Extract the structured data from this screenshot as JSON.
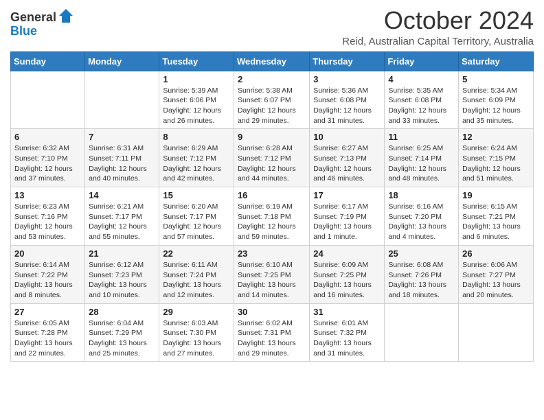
{
  "header": {
    "logo_general": "General",
    "logo_blue": "Blue",
    "title": "October 2024",
    "location": "Reid, Australian Capital Territory, Australia"
  },
  "weekdays": [
    "Sunday",
    "Monday",
    "Tuesday",
    "Wednesday",
    "Thursday",
    "Friday",
    "Saturday"
  ],
  "weeks": [
    [
      {
        "day": "",
        "info": ""
      },
      {
        "day": "",
        "info": ""
      },
      {
        "day": "1",
        "info": "Sunrise: 5:39 AM\nSunset: 6:06 PM\nDaylight: 12 hours and 26 minutes."
      },
      {
        "day": "2",
        "info": "Sunrise: 5:38 AM\nSunset: 6:07 PM\nDaylight: 12 hours and 29 minutes."
      },
      {
        "day": "3",
        "info": "Sunrise: 5:36 AM\nSunset: 6:08 PM\nDaylight: 12 hours and 31 minutes."
      },
      {
        "day": "4",
        "info": "Sunrise: 5:35 AM\nSunset: 6:08 PM\nDaylight: 12 hours and 33 minutes."
      },
      {
        "day": "5",
        "info": "Sunrise: 5:34 AM\nSunset: 6:09 PM\nDaylight: 12 hours and 35 minutes."
      }
    ],
    [
      {
        "day": "6",
        "info": "Sunrise: 6:32 AM\nSunset: 7:10 PM\nDaylight: 12 hours and 37 minutes."
      },
      {
        "day": "7",
        "info": "Sunrise: 6:31 AM\nSunset: 7:11 PM\nDaylight: 12 hours and 40 minutes."
      },
      {
        "day": "8",
        "info": "Sunrise: 6:29 AM\nSunset: 7:12 PM\nDaylight: 12 hours and 42 minutes."
      },
      {
        "day": "9",
        "info": "Sunrise: 6:28 AM\nSunset: 7:12 PM\nDaylight: 12 hours and 44 minutes."
      },
      {
        "day": "10",
        "info": "Sunrise: 6:27 AM\nSunset: 7:13 PM\nDaylight: 12 hours and 46 minutes."
      },
      {
        "day": "11",
        "info": "Sunrise: 6:25 AM\nSunset: 7:14 PM\nDaylight: 12 hours and 48 minutes."
      },
      {
        "day": "12",
        "info": "Sunrise: 6:24 AM\nSunset: 7:15 PM\nDaylight: 12 hours and 51 minutes."
      }
    ],
    [
      {
        "day": "13",
        "info": "Sunrise: 6:23 AM\nSunset: 7:16 PM\nDaylight: 12 hours and 53 minutes."
      },
      {
        "day": "14",
        "info": "Sunrise: 6:21 AM\nSunset: 7:17 PM\nDaylight: 12 hours and 55 minutes."
      },
      {
        "day": "15",
        "info": "Sunrise: 6:20 AM\nSunset: 7:17 PM\nDaylight: 12 hours and 57 minutes."
      },
      {
        "day": "16",
        "info": "Sunrise: 6:19 AM\nSunset: 7:18 PM\nDaylight: 12 hours and 59 minutes."
      },
      {
        "day": "17",
        "info": "Sunrise: 6:17 AM\nSunset: 7:19 PM\nDaylight: 13 hours and 1 minute."
      },
      {
        "day": "18",
        "info": "Sunrise: 6:16 AM\nSunset: 7:20 PM\nDaylight: 13 hours and 4 minutes."
      },
      {
        "day": "19",
        "info": "Sunrise: 6:15 AM\nSunset: 7:21 PM\nDaylight: 13 hours and 6 minutes."
      }
    ],
    [
      {
        "day": "20",
        "info": "Sunrise: 6:14 AM\nSunset: 7:22 PM\nDaylight: 13 hours and 8 minutes."
      },
      {
        "day": "21",
        "info": "Sunrise: 6:12 AM\nSunset: 7:23 PM\nDaylight: 13 hours and 10 minutes."
      },
      {
        "day": "22",
        "info": "Sunrise: 6:11 AM\nSunset: 7:24 PM\nDaylight: 13 hours and 12 minutes."
      },
      {
        "day": "23",
        "info": "Sunrise: 6:10 AM\nSunset: 7:25 PM\nDaylight: 13 hours and 14 minutes."
      },
      {
        "day": "24",
        "info": "Sunrise: 6:09 AM\nSunset: 7:25 PM\nDaylight: 13 hours and 16 minutes."
      },
      {
        "day": "25",
        "info": "Sunrise: 6:08 AM\nSunset: 7:26 PM\nDaylight: 13 hours and 18 minutes."
      },
      {
        "day": "26",
        "info": "Sunrise: 6:06 AM\nSunset: 7:27 PM\nDaylight: 13 hours and 20 minutes."
      }
    ],
    [
      {
        "day": "27",
        "info": "Sunrise: 6:05 AM\nSunset: 7:28 PM\nDaylight: 13 hours and 22 minutes."
      },
      {
        "day": "28",
        "info": "Sunrise: 6:04 AM\nSunset: 7:29 PM\nDaylight: 13 hours and 25 minutes."
      },
      {
        "day": "29",
        "info": "Sunrise: 6:03 AM\nSunset: 7:30 PM\nDaylight: 13 hours and 27 minutes."
      },
      {
        "day": "30",
        "info": "Sunrise: 6:02 AM\nSunset: 7:31 PM\nDaylight: 13 hours and 29 minutes."
      },
      {
        "day": "31",
        "info": "Sunrise: 6:01 AM\nSunset: 7:32 PM\nDaylight: 13 hours and 31 minutes."
      },
      {
        "day": "",
        "info": ""
      },
      {
        "day": "",
        "info": ""
      }
    ]
  ]
}
